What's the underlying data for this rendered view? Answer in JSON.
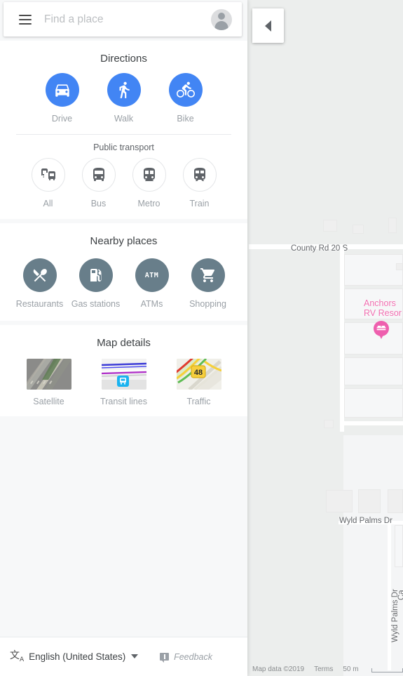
{
  "search": {
    "placeholder": "Find a place",
    "value": "",
    "menu_icon": "hamburger-menu-icon",
    "avatar_icon": "account-avatar-icon"
  },
  "collapse": {
    "icon": "chevron-left-icon",
    "label": ""
  },
  "sections": {
    "directions": {
      "title": "Directions",
      "modes": [
        {
          "label": "Drive",
          "icon": "car-icon"
        },
        {
          "label": "Walk",
          "icon": "pedestrian-icon"
        },
        {
          "label": "Bike",
          "icon": "bicycle-icon"
        }
      ],
      "transit_title": "Public transport",
      "transit": [
        {
          "label": "All",
          "icon": "transit-all-icon"
        },
        {
          "label": "Bus",
          "icon": "bus-icon"
        },
        {
          "label": "Metro",
          "icon": "subway-icon"
        },
        {
          "label": "Train",
          "icon": "train-icon"
        }
      ]
    },
    "nearby": {
      "title": "Nearby places",
      "items": [
        {
          "label": "Restaurants",
          "icon": "restaurant-cutlery-icon"
        },
        {
          "label": "Gas stations",
          "icon": "gas-pump-icon"
        },
        {
          "label": "ATMs",
          "icon": "atm-icon"
        },
        {
          "label": "Shopping",
          "icon": "shopping-cart-icon"
        }
      ]
    },
    "map_details": {
      "title": "Map details",
      "items": [
        {
          "label": "Satellite",
          "icon": "satellite-thumbnail"
        },
        {
          "label": "Transit lines",
          "icon": "transit-lines-thumbnail"
        },
        {
          "label": "Traffic",
          "icon": "traffic-thumbnail"
        }
      ]
    }
  },
  "footer": {
    "language": "English (United States)",
    "language_icon": "translate-icon",
    "feedback": "Feedback",
    "feedback_icon": "feedback-icon"
  },
  "map": {
    "labels": [
      {
        "text": "County Rd 20 S"
      },
      {
        "text": "Wyld Palms Dr"
      },
      {
        "text": "Wyld Palms Dr"
      },
      {
        "text": "Ca"
      }
    ],
    "poi": {
      "name_line1": "Anchors",
      "name_line2": "RV Resor",
      "marker_icon": "hotel-bed-marker-icon",
      "color": "#ee5fae"
    },
    "attribution": {
      "data": "Map data ©2019",
      "terms": "Terms",
      "scale": "50 m"
    }
  },
  "colors": {
    "accent_blue": "#4285f4",
    "slate": "#687e8a",
    "poi_pink": "#ee5fae",
    "panel_bg": "#f7f8f9",
    "card_bg": "#ffffff",
    "map_bg": "#eceeed"
  }
}
